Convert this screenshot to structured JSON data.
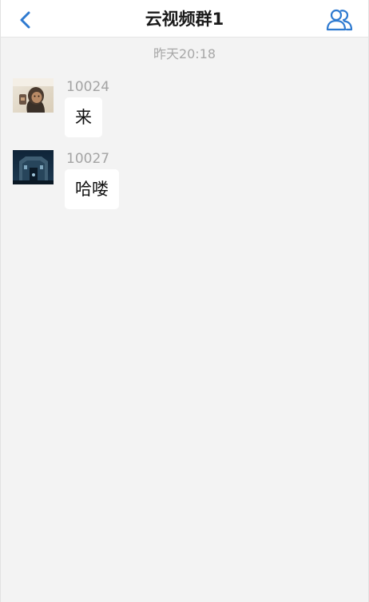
{
  "nav": {
    "title": "云视频群1",
    "back_icon": "chevron-left-icon",
    "members_icon": "group-members-icon",
    "accent_color": "#2e7ad0"
  },
  "chat": {
    "timestamp": "昨天20:18",
    "messages": [
      {
        "sender": "10024",
        "text": "来",
        "avatar": "user-photo-avatar"
      },
      {
        "sender": "10027",
        "text": "哈喽",
        "avatar": "user-photo-avatar"
      }
    ]
  }
}
